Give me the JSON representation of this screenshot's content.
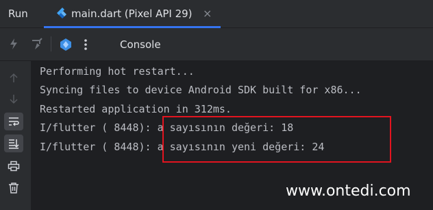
{
  "tabbar": {
    "run_label": "Run",
    "tab": {
      "label": "main.dart (Pixel API 29)",
      "icon": "dart-icon"
    },
    "close_glyph": "×"
  },
  "toolbar": {
    "console_label": "Console",
    "icons": [
      "hot-reload-icon",
      "hot-restart-icon",
      "flutter-devtools-icon",
      "more-options-icon"
    ]
  },
  "sidebar": {
    "icons": [
      "arrow-up-icon",
      "arrow-down-icon",
      "soft-wrap-icon",
      "scroll-to-end-icon",
      "print-icon",
      "trash-icon"
    ]
  },
  "console": {
    "lines": [
      "Performing hot restart...",
      "Syncing files to device Android SDK built for x86...",
      "Restarted application in 312ms.",
      "I/flutter ( 8448): a sayısının değeri: 18",
      "I/flutter ( 8448): a sayısının yeni değeri: 24"
    ]
  },
  "watermark": "www.ontedi.com",
  "colors": {
    "accent": "#3574f0",
    "highlight": "#e3141f",
    "background": "#2b2d30",
    "console_bg": "#1e1f22"
  }
}
